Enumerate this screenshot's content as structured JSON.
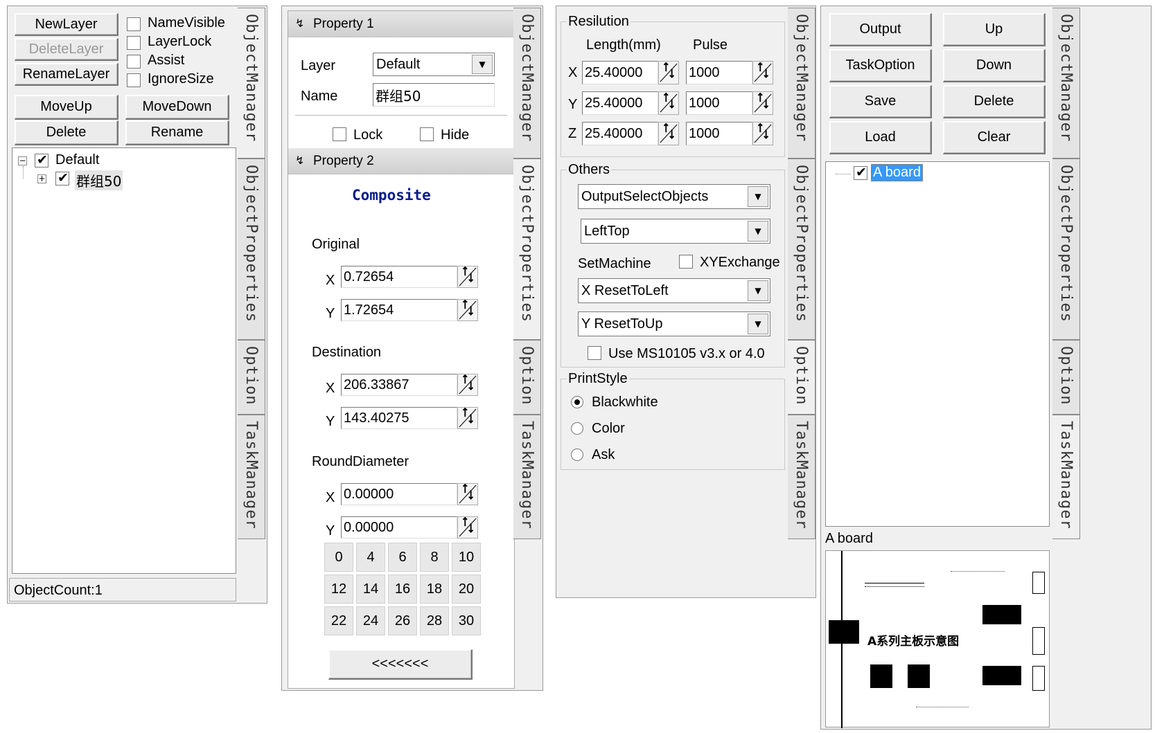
{
  "tabs": {
    "object_manager": "ObjectManager",
    "object_properties": "ObjectProperties",
    "option": "Option",
    "task_manager": "TaskManager"
  },
  "object_manager": {
    "buttons": {
      "new_layer": "NewLayer",
      "delete_layer": "DeleteLayer",
      "rename_layer": "RenameLayer",
      "move_up": "MoveUp",
      "move_down": "MoveDown",
      "delete": "Delete",
      "rename": "Rename"
    },
    "checks": {
      "name_visible": "NameVisible",
      "layer_lock": "LayerLock",
      "assist": "Assist",
      "ignore_size": "IgnoreSize"
    },
    "tree": {
      "root_label": "Default",
      "root_checked": true,
      "child_label": "群组50",
      "child_checked": true,
      "root_expander": "−",
      "child_expander": "+"
    },
    "status": "ObjectCount:1"
  },
  "object_properties": {
    "section1": "Property 1",
    "layer_label": "Layer",
    "layer_value": "Default",
    "name_label": "Name",
    "name_value": "群组50",
    "lock_label": "Lock",
    "hide_label": "Hide",
    "section2": "Property 2",
    "object_type": "Composite",
    "original_label": "Original",
    "original_x": "0.72654",
    "original_y": "1.72654",
    "destination_label": "Destination",
    "destination_x": "206.33867",
    "destination_y": "143.40275",
    "round_label": "RoundDiameter",
    "round_x": "0.00000",
    "round_y": "0.00000",
    "x_label": "X",
    "y_label": "Y",
    "diameters": [
      "0",
      "4",
      "6",
      "8",
      "10",
      "12",
      "14",
      "16",
      "18",
      "20",
      "22",
      "24",
      "26",
      "28",
      "30"
    ],
    "collapse_button": "<<<<<<<"
  },
  "option": {
    "resolution_title": "Resilution",
    "length_header": "Length(mm)",
    "pulse_header": "Pulse",
    "rows": [
      {
        "axis": "X",
        "length": "25.40000",
        "pulse": "1000"
      },
      {
        "axis": "Y",
        "length": "25.40000",
        "pulse": "1000"
      },
      {
        "axis": "Z",
        "length": "25.40000",
        "pulse": "1000"
      }
    ],
    "others_title": "Others",
    "output_select": "OutputSelectObjects",
    "origin_select": "LeftTop",
    "set_machine_label": "SetMachine",
    "xy_exchange_label": "XYExchange",
    "x_reset": "X ResetToLeft",
    "y_reset": "Y ResetToUp",
    "ms_label": "Use MS10105 v3.x or 4.0",
    "print_style_title": "PrintStyle",
    "print_styles": [
      "Blackwhite",
      "Color",
      "Ask"
    ],
    "print_style_selected": "Blackwhite"
  },
  "task_manager": {
    "buttons": {
      "output": "Output",
      "up": "Up",
      "task_option": "TaskOption",
      "down": "Down",
      "save": "Save",
      "delete": "Delete",
      "load": "Load",
      "clear": "Clear"
    },
    "task_item": "A board",
    "task_checked": true,
    "preview_title": "A board",
    "preview_text": "A系列主板示意图"
  }
}
